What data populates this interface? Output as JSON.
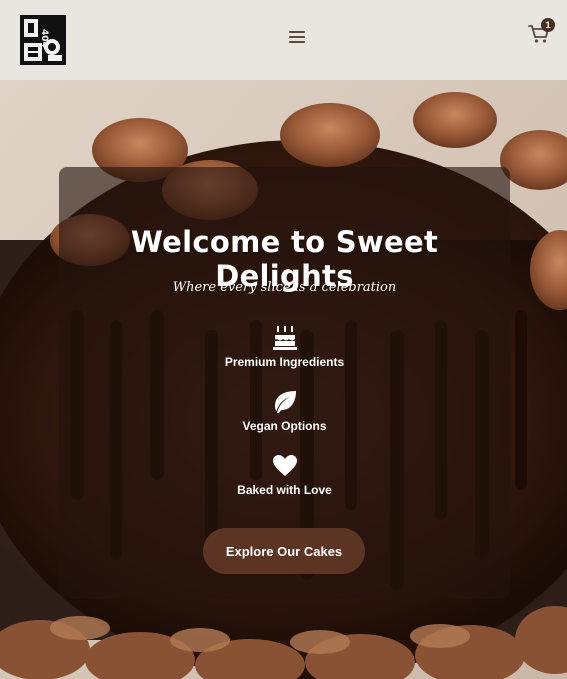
{
  "header": {
    "logo_text": "404 SO",
    "menu_icon": "hamburger-menu-icon",
    "cart_icon": "shopping-cart-icon",
    "cart_count": "1"
  },
  "hero": {
    "title": "Welcome to Sweet Delights",
    "subtitle": "Where every slice is a celebration",
    "features": [
      {
        "icon": "birthday-cake-icon",
        "label": "Premium Ingredients"
      },
      {
        "icon": "leaf-icon",
        "label": "Vegan Options"
      },
      {
        "icon": "heart-icon",
        "label": "Baked with Love"
      }
    ],
    "cta_label": "Explore Our Cakes"
  },
  "colors": {
    "header_bg": "#e9e5df",
    "card_overlay": "#23140e",
    "button_bg": "#5c3423",
    "badge_bg": "#4a2e22",
    "icon_color": "#5a4a40"
  }
}
